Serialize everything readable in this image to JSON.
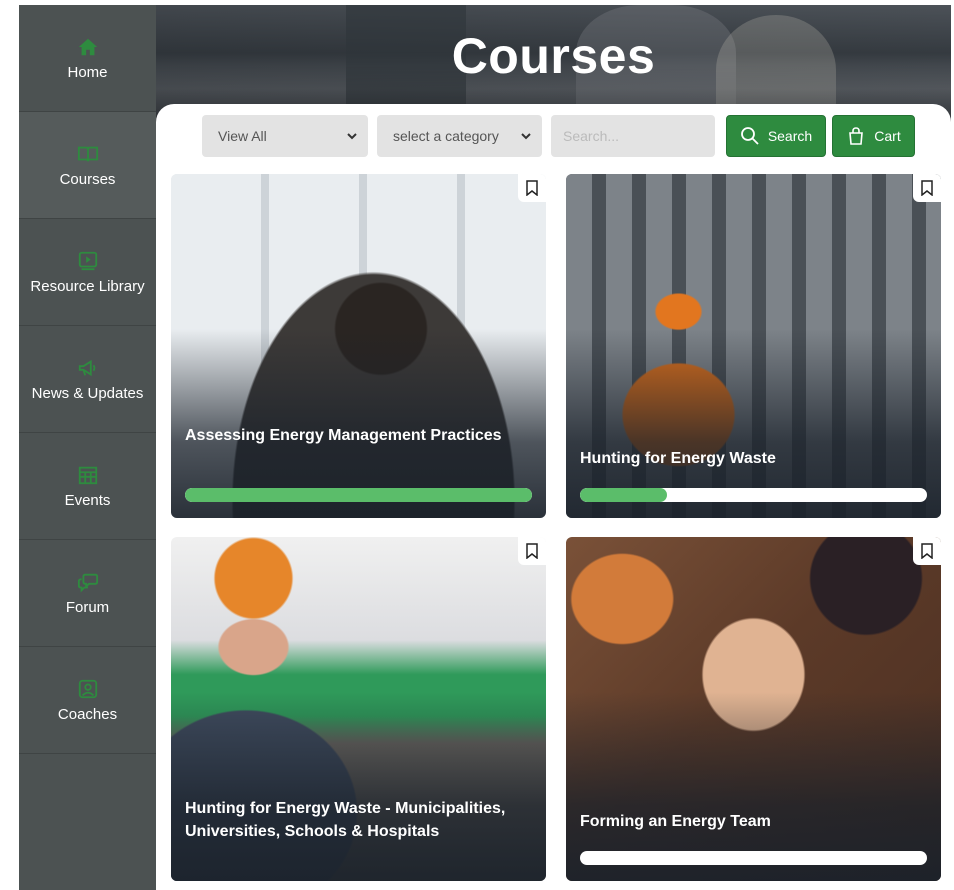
{
  "sidebar": {
    "items": [
      {
        "label": "Home",
        "icon": "home-icon"
      },
      {
        "label": "Courses",
        "icon": "book-icon"
      },
      {
        "label": "Resource Library",
        "icon": "video-library-icon"
      },
      {
        "label": "News & Updates",
        "icon": "megaphone-icon"
      },
      {
        "label": "Events",
        "icon": "calendar-grid-icon"
      },
      {
        "label": "Forum",
        "icon": "chat-bubbles-icon"
      },
      {
        "label": "Coaches",
        "icon": "coach-profile-icon"
      }
    ],
    "active_index": 1
  },
  "hero": {
    "title": "Courses"
  },
  "filters": {
    "view_select_value": "View All",
    "category_select_value": "select a category",
    "search_placeholder": "Search...",
    "search_button": "Search",
    "cart_button": "Cart"
  },
  "courses": [
    {
      "title": "Assessing Energy Management Practices",
      "progress": 1.0
    },
    {
      "title": "Hunting for Energy Waste",
      "progress": 0.25
    },
    {
      "title": "Hunting for Energy Waste - Municipalities, Universities, Schools & Hospitals",
      "progress": null
    },
    {
      "title": "Forming an Energy Team",
      "progress": 0.0
    }
  ],
  "colors": {
    "accent_green": "#2e8b3f",
    "sidebar_bg": "#4c5252",
    "sidebar_icon": "#2e8b3f",
    "progress_fill": "#5bbd6a"
  }
}
